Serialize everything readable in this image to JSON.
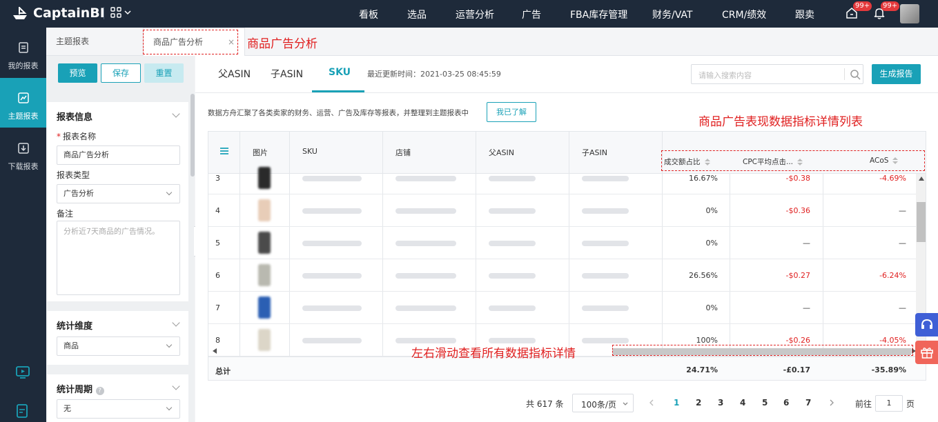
{
  "app": {
    "brand": "CaptainBI",
    "accent": "#19a1b7",
    "nav_bg": "#1e2a3a"
  },
  "nav": {
    "items": [
      "看板",
      "选品",
      "运营分析",
      "广告",
      "FBA库存管理",
      "财务/VAT",
      "CRM/绩效",
      "跟卖"
    ],
    "badge1": "99+",
    "badge2": "99+"
  },
  "sidebar": {
    "items": [
      "我的报表",
      "主题报表",
      "下载报表"
    ]
  },
  "tabs": {
    "tab1": "主题报表",
    "tab2": "商品广告分析"
  },
  "annotations": {
    "a1": "商品广告分析",
    "a2": "商品广告表现数据指标详情列表",
    "a3": "左右滑动查看所有数据指标详情"
  },
  "left_panel": {
    "buttons": {
      "preview": "预览",
      "save": "保存",
      "reset": "重置"
    },
    "info_title": "报表信息",
    "name_label": "报表名称",
    "name_value": "商品广告分析",
    "type_label": "报表类型",
    "type_value": "广告分析",
    "note_label": "备注",
    "note_placeholder": "分析近7天商品的广告情况。",
    "dimension_title": "统计维度",
    "dimension_value": "商品",
    "period_title": "统计周期",
    "period_value": "无"
  },
  "main": {
    "subtabs": [
      "父ASIN",
      "子ASIN",
      "SKU"
    ],
    "active_subtab": "SKU",
    "updated": "最近更新时间：2021-03-25 08:45:59",
    "search_placeholder": "请输入搜索内容",
    "generate_button": "生成报告",
    "notice": "数据方舟汇聚了各类卖家的财务、运营、广告及库存等报表，并整理到主题报表中",
    "ack_button": "我已了解"
  },
  "table": {
    "columns": [
      "图片",
      "SKU",
      "店铺",
      "父ASIN",
      "子ASIN",
      "成交额占比",
      "CPC平均点击...",
      "ACoS"
    ],
    "rows": [
      {
        "idx": "3",
        "share": "16.67%",
        "cpc": "-$0.38",
        "acos": "-4.69%",
        "color": "#2a2a2a"
      },
      {
        "idx": "4",
        "share": "0%",
        "cpc": "-$0.36",
        "acos": "—",
        "color": "#e8cdb8"
      },
      {
        "idx": "5",
        "share": "0%",
        "cpc": "—",
        "acos": "—",
        "color": "#4b4b4b"
      },
      {
        "idx": "6",
        "share": "26.56%",
        "cpc": "-$0.27",
        "acos": "-6.24%",
        "color": "#b9b9b0"
      },
      {
        "idx": "7",
        "share": "0%",
        "cpc": "—",
        "acos": "—",
        "color": "#2b5fb3"
      },
      {
        "idx": "8",
        "share": "100%",
        "cpc": "-$0.26",
        "acos": "-4.05%",
        "color": "#dcd6c8"
      }
    ],
    "total_label": "总计",
    "total_share": "24.71%",
    "total_cpc": "-£0.17",
    "total_acos": "-35.89%"
  },
  "pager": {
    "total": "共 617 条",
    "page_size": "100条/页",
    "pages": [
      "1",
      "2",
      "3",
      "4",
      "5",
      "6",
      "7"
    ],
    "goto_label": "前往",
    "goto_value": "1",
    "goto_suffix": "页"
  }
}
